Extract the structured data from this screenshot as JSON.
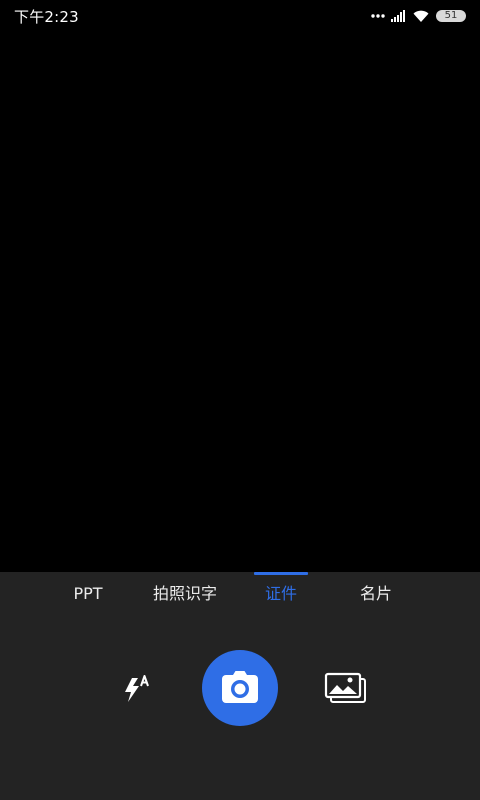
{
  "status_bar": {
    "time": "下午2:23",
    "battery_level": "51",
    "icons": [
      "dots-icon",
      "signal-icon",
      "wifi-icon",
      "battery-icon"
    ]
  },
  "top_bar": {
    "back_icon": "chevron-left-icon",
    "settings_icon": "gear-icon"
  },
  "modes": {
    "tabs": [
      {
        "label": "PPT",
        "active": false
      },
      {
        "label": "拍照识字",
        "active": false
      },
      {
        "label": "证件",
        "active": true
      },
      {
        "label": "名片",
        "active": false
      }
    ]
  },
  "controls": {
    "flash_icon": "flash-auto-icon",
    "shutter_icon": "camera-icon",
    "gallery_icon": "gallery-icon"
  },
  "colors": {
    "accent": "#2f6ee6",
    "panel_background": "#232323",
    "viewfinder_background": "#000000"
  }
}
